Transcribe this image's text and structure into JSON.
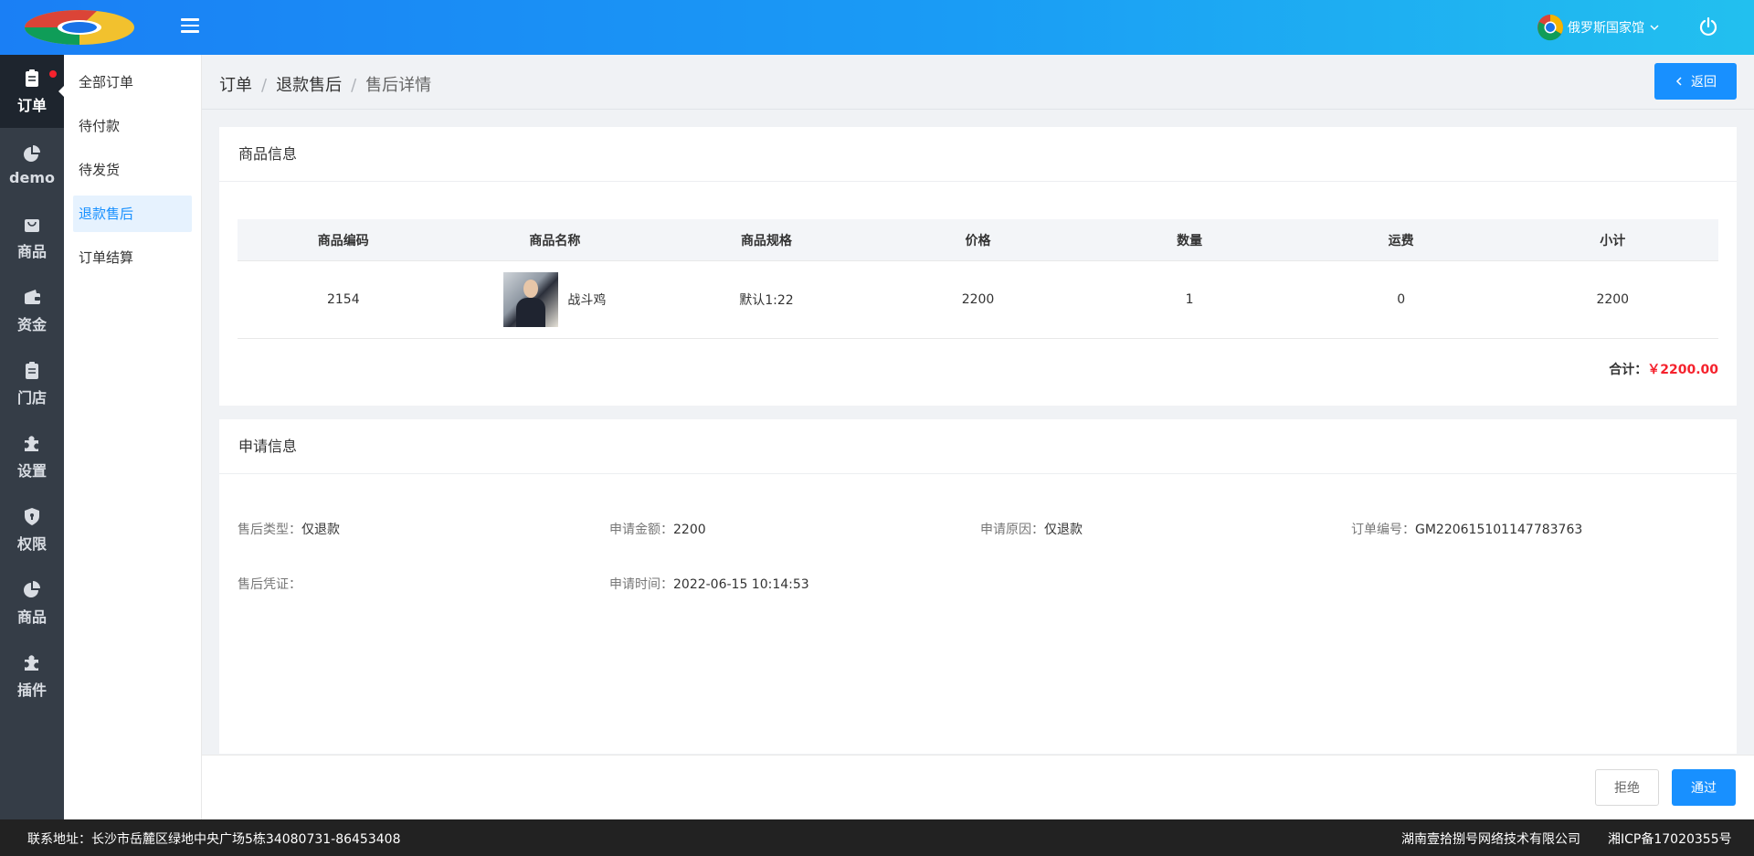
{
  "header": {
    "store_name": "俄罗斯国家馆"
  },
  "sidebar": {
    "items": [
      {
        "label": "订单",
        "icon": "clipboard-icon"
      },
      {
        "label": "demo",
        "icon": "pie-chart-icon"
      },
      {
        "label": "商品",
        "icon": "bag-icon"
      },
      {
        "label": "资金",
        "icon": "wallet-icon"
      },
      {
        "label": "门店",
        "icon": "clipboard-icon"
      },
      {
        "label": "设置",
        "icon": "puzzle-icon"
      },
      {
        "label": "权限",
        "icon": "shield-icon"
      },
      {
        "label": "商品",
        "icon": "pie-chart-icon"
      },
      {
        "label": "插件",
        "icon": "puzzle-icon"
      }
    ]
  },
  "submenu": {
    "items": [
      "全部订单",
      "待付款",
      "待发货",
      "退款售后",
      "订单结算"
    ],
    "active": "退款售后"
  },
  "breadcrumb": {
    "items": [
      "订单",
      "退款售后",
      "售后详情"
    ],
    "separator": "/"
  },
  "back_button": "返回",
  "product_card": {
    "title": "商品信息",
    "columns": [
      "商品编码",
      "商品名称",
      "商品规格",
      "价格",
      "数量",
      "运费",
      "小计"
    ],
    "rows": [
      {
        "code": "2154",
        "name": "战斗鸡",
        "spec": "默认1:22",
        "price": "2200",
        "qty": "1",
        "shipping": "0",
        "subtotal": "2200"
      }
    ],
    "total_label": "合计：",
    "total_value": "￥2200.00"
  },
  "apply_card": {
    "title": "申请信息",
    "fields": {
      "type": {
        "label": "售后类型：",
        "value": "仅退款"
      },
      "amount": {
        "label": "申请金额：",
        "value": "2200"
      },
      "reason": {
        "label": "申请原因：",
        "value": "仅退款"
      },
      "order_no": {
        "label": "订单编号：",
        "value": "GM220615101147783763"
      },
      "proof": {
        "label": "售后凭证：",
        "value": ""
      },
      "time": {
        "label": "申请时间：",
        "value": "2022-06-15 10:14:53"
      }
    }
  },
  "actions": {
    "reject": "拒绝",
    "pass": "通过"
  },
  "footer": {
    "address": "联系地址：长沙市岳麓区绿地中央广场5栋34080731-86453408",
    "company": "湖南壹拾捌号网络技术有限公司",
    "icp": "湘ICP备17020355号"
  },
  "colors": {
    "primary": "#1890ff",
    "sidebar_bg": "#353d47",
    "danger": "#f5222d"
  }
}
